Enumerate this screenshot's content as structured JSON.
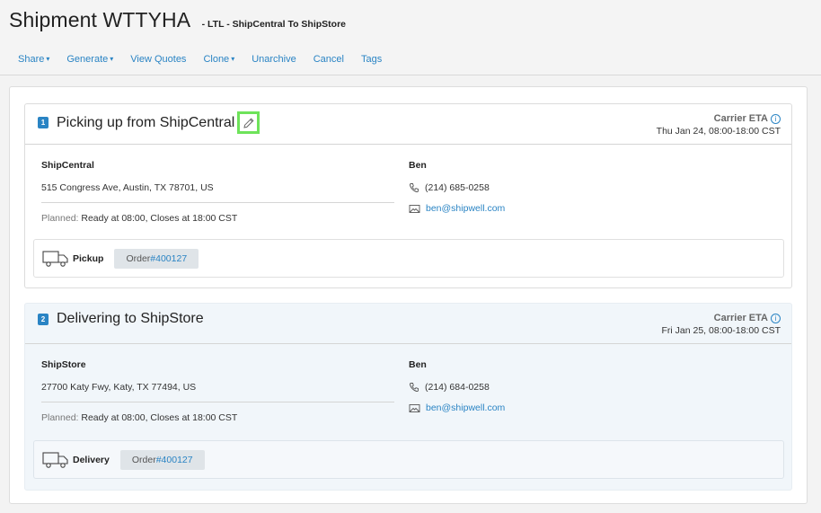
{
  "header": {
    "title": "Shipment WTTYHA",
    "subtitle": "- LTL - ShipCentral To ShipStore"
  },
  "nav": {
    "items": [
      {
        "label": "Share",
        "dropdown": true
      },
      {
        "label": "Generate",
        "dropdown": true
      },
      {
        "label": "View Quotes",
        "dropdown": false
      },
      {
        "label": "Clone",
        "dropdown": true
      },
      {
        "label": "Unarchive",
        "dropdown": false
      },
      {
        "label": "Cancel",
        "dropdown": false
      },
      {
        "label": "Tags",
        "dropdown": false
      }
    ],
    "caret": "▾"
  },
  "stops": [
    {
      "number": "1",
      "title": "Picking up from ShipCentral",
      "eta_label": "Carrier ETA",
      "eta_value": "Thu Jan 24, 08:00-18:00 CST",
      "company": "ShipCentral",
      "address": "515 Congress Ave, Austin, TX 78701, US",
      "planned_label": "Planned:",
      "planned_value": "Ready at 08:00, Closes at 18:00 CST",
      "contact_name": "Ben",
      "phone": "(214) 685-0258",
      "email": "ben@shipwell.com",
      "action_label": "Pickup",
      "order_label": "Order",
      "order_number": "#400127",
      "icons": [
        "number-badge-icon",
        "pencil-edit-icon",
        "info-icon",
        "phone-icon",
        "envelope-icon",
        "truck-icon"
      ]
    },
    {
      "number": "2",
      "title": "Delivering to ShipStore",
      "eta_label": "Carrier ETA",
      "eta_value": "Fri Jan 25, 08:00-18:00 CST",
      "company": "ShipStore",
      "address": "27700 Katy Fwy, Katy, TX 77494, US",
      "planned_label": "Planned:",
      "planned_value": "Ready at 08:00, Closes at 18:00 CST",
      "contact_name": "Ben",
      "phone": "(214) 684-0258",
      "email": "ben@shipwell.com",
      "action_label": "Delivery",
      "order_label": "Order",
      "order_number": "#400127",
      "icons": [
        "number-badge-icon",
        "info-icon",
        "phone-icon",
        "envelope-icon",
        "truck-icon"
      ]
    }
  ],
  "colors": {
    "link": "#2a84c4",
    "edit_highlight": "#6ee35a",
    "stop2_background": "#f1f6fa"
  }
}
